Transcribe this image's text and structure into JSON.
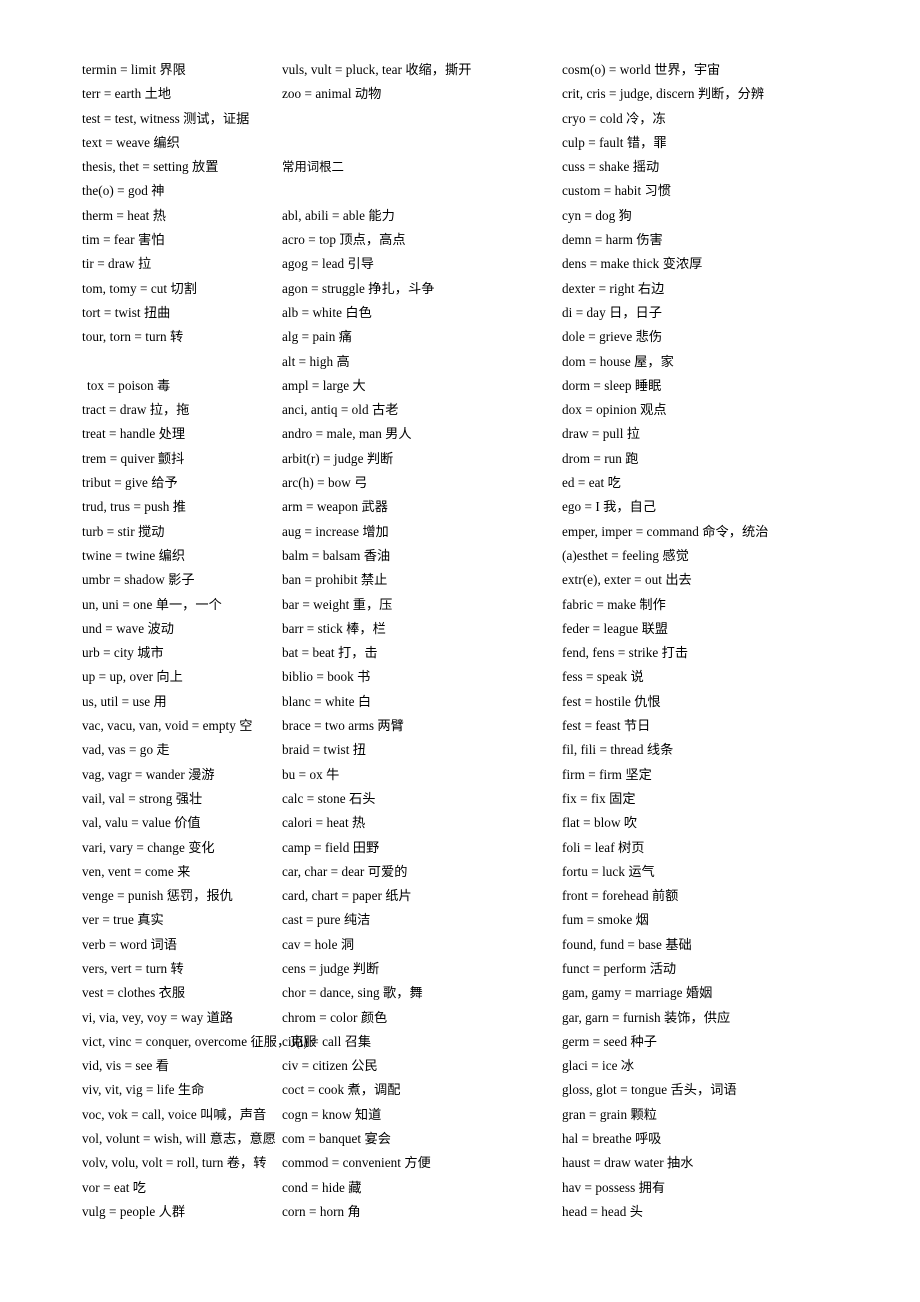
{
  "document": {
    "title": "常用词根",
    "section_heading": "常用词根二"
  },
  "columns": [
    {
      "id": "column-1",
      "blocks": [
        {
          "type": "entries",
          "items": [
            "termin = limit 界限",
            "terr = earth 土地",
            "test = test, witness 测试，证据",
            "text = weave 编织",
            "thesis, thet = setting 放置",
            "the(o) = god 神",
            "therm = heat 热",
            "tim = fear 害怕",
            "tir = draw 拉",
            "tom, tomy = cut 切割",
            "tort = twist 扭曲",
            "tour, torn = turn 转"
          ]
        },
        {
          "type": "spacer",
          "lines": 1
        },
        {
          "type": "entries",
          "indent": true,
          "items": [
            " tox = poison 毒"
          ]
        },
        {
          "type": "entries",
          "items": [
            "tract = draw 拉，拖",
            "treat = handle 处理",
            "trem = quiver 颤抖",
            "tribut = give 给予",
            "trud, trus = push 推",
            "turb = stir 搅动",
            "twine = twine 编织",
            "umbr = shadow 影子",
            "un, uni = one 单一，一个",
            "und = wave 波动",
            "urb = city 城市",
            "up = up, over 向上",
            "us, util = use 用",
            "vac, vacu, van, void = empty 空",
            "vad, vas = go 走",
            "vag, vagr = wander 漫游",
            "vail, val = strong 强壮",
            "val, valu = value 价值",
            "vari, vary = change 变化",
            "ven, vent = come 来",
            "venge = punish 惩罚，报仇",
            "ver = true 真实",
            "verb = word 词语",
            "vers, vert = turn 转",
            "vest = clothes 衣服",
            "vi, via, vey, voy = way 道路",
            "vict, vinc = conquer, overcome 征服，克服",
            "vid, vis = see 看",
            "viv, vit, vig = life 生命",
            "voc, vok = call, voice 叫喊，声音",
            "vol, volunt = wish, will 意志，意愿",
            "volv, volu, volt = roll, turn 卷，转",
            "vor = eat 吃",
            "vulg = people 人群"
          ]
        }
      ]
    },
    {
      "id": "column-2",
      "blocks": [
        {
          "type": "entries",
          "items": [
            "vuls, vult = pluck, tear 收缩，撕开",
            "zoo = animal 动物"
          ]
        },
        {
          "type": "spacer",
          "lines": 2
        },
        {
          "type": "heading",
          "text": "常用词根二"
        },
        {
          "type": "spacer",
          "lines": 1
        },
        {
          "type": "entries",
          "items": [
            "abl, abili = able 能力",
            "acro = top 顶点，高点",
            "agog = lead 引导",
            "agon = struggle 挣扎，斗争",
            "alb = white 白色",
            "alg = pain 痛",
            "alt = high 高",
            "ampl = large 大",
            "anci, antiq = old 古老",
            "andro = male, man 男人",
            "arbit(r) = judge 判断",
            "arc(h) = bow 弓",
            "arm = weapon 武器",
            "aug = increase 增加",
            "balm = balsam 香油",
            "ban = prohibit 禁止",
            "bar = weight 重，压",
            "barr = stick 棒，栏",
            "bat = beat 打，击",
            "biblio = book 书",
            "blanc = white 白",
            "brace = two arms 两臂",
            "braid = twist 扭",
            "bu = ox 牛",
            "calc = stone 石头",
            "calori = heat 热",
            "camp = field 田野",
            "car, char = dear 可爱的",
            "card, chart = paper 纸片",
            "cast = pure 纯洁",
            "cav = hole 洞",
            "cens = judge 判断",
            "chor = dance, sing 歌，舞",
            "chrom = color 颜色",
            "cil(i) = call 召集",
            "civ = citizen 公民",
            "coct = cook 煮，调配",
            "cogn = know 知道",
            "com = banquet 宴会",
            "commod = convenient 方便",
            "cond = hide 藏",
            "corn = horn 角"
          ]
        }
      ]
    },
    {
      "id": "column-3",
      "blocks": [
        {
          "type": "entries",
          "items": [
            "cosm(o) = world 世界，宇宙",
            "crit, cris = judge, discern 判断，分辨",
            "cryo = cold 冷，冻",
            "culp = fault 错，罪",
            "cuss = shake 摇动",
            "custom = habit 习惯",
            "cyn = dog 狗",
            "demn = harm 伤害",
            "dens = make thick 变浓厚",
            "dexter = right 右边",
            "di = day 日，日子",
            "dole = grieve 悲伤",
            "dom = house 屋，家",
            "dorm = sleep 睡眠",
            "dox = opinion 观点",
            "draw = pull 拉",
            "drom = run 跑",
            "ed = eat 吃",
            "ego = I 我，自己",
            "emper, imper = command 命令，统治",
            "(a)esthet = feeling 感觉",
            "extr(e), exter = out 出去",
            "fabric = make 制作",
            "feder = league 联盟",
            "fend, fens = strike 打击",
            "fess = speak 说",
            "fest = hostile 仇恨",
            "fest = feast 节日",
            "fil, fili = thread 线条",
            "firm = firm 坚定",
            "fix = fix 固定",
            "flat = blow 吹",
            "foli = leaf 树页",
            "fortu = luck 运气",
            "front = forehead 前额",
            "fum = smoke 烟",
            "found, fund = base 基础",
            "funct = perform 活动",
            "gam, gamy = marriage 婚姻",
            "gar, garn = furnish 装饰，供应",
            "germ = seed 种子",
            "glaci = ice 冰",
            "gloss, glot = tongue 舌头，词语",
            "gran = grain 颗粒",
            "hal = breathe 呼吸",
            "haust = draw water 抽水",
            "hav = possess 拥有",
            "head = head 头"
          ]
        }
      ]
    }
  ]
}
